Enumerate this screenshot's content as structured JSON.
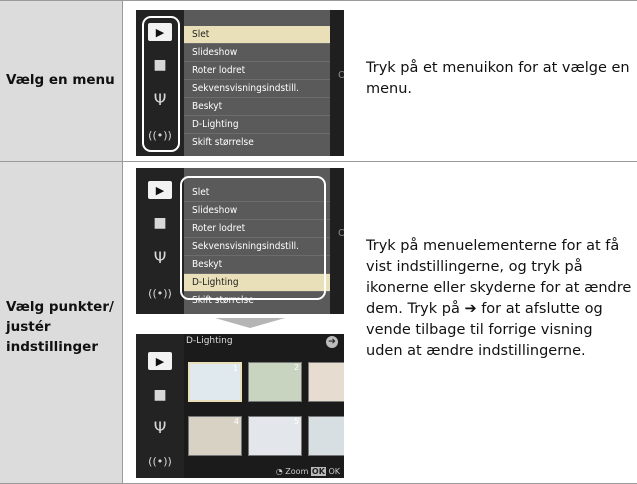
{
  "rows": [
    {
      "label": "Vælg en menu",
      "description": "Tryk på et menuikon for at vælge en menu."
    },
    {
      "label_lines": [
        "Vælg punkter/",
        "justér",
        "indstillinger"
      ],
      "description": "Tryk på menuelementerne for at få vist indstillingerne, og tryk på ikonerne eller skyderne for at ændre dem. Tryk på ➔ for at afslutte og vende tilbage til forrige visning uden at ændre indstillingerne."
    }
  ],
  "menu": {
    "items": [
      "Slet",
      "Slideshow",
      "Roter lodret",
      "Sekvensvisningsindstill.",
      "Beskyt",
      "D-Lighting",
      "Skift størrelse"
    ],
    "value_label": "ON"
  },
  "dlighting": {
    "title": "D-Lighting",
    "thumb_numbers": [
      "1",
      "2",
      "3",
      "4",
      "5",
      "6"
    ],
    "zoom_label": "Zoom",
    "ok_label": "OK"
  },
  "colors": {
    "label_bg": "#dcdcdc",
    "menu_bg": "#5a5a5a",
    "selected_item": "#e9e0b9",
    "screen_bg": "#1b1b1b"
  }
}
